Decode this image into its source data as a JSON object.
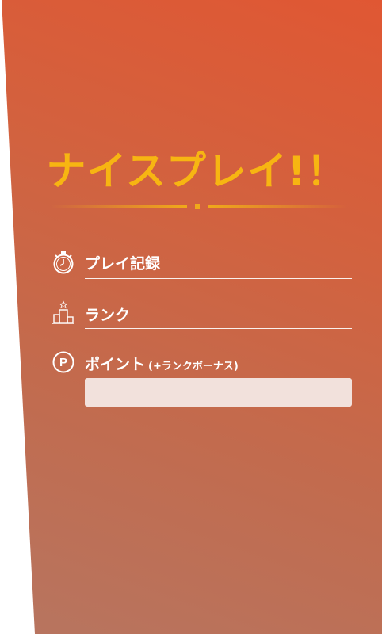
{
  "result": {
    "title": "ナイスプレイ!！"
  },
  "fields": {
    "play_record": {
      "label": "プレイ記録",
      "icon": "stopwatch-icon",
      "value": ""
    },
    "rank": {
      "label": "ランク",
      "icon": "podium-icon",
      "value": ""
    },
    "points": {
      "label": "ポイント",
      "sublabel": "(+ランクボーナス)",
      "icon": "points-p-icon",
      "value": ""
    }
  },
  "colors": {
    "title": "#f7b512",
    "divider": "#f0a91a",
    "panel_top": "#e05733",
    "panel_bottom": "#b77560",
    "points_box": "#f2e1dc"
  }
}
